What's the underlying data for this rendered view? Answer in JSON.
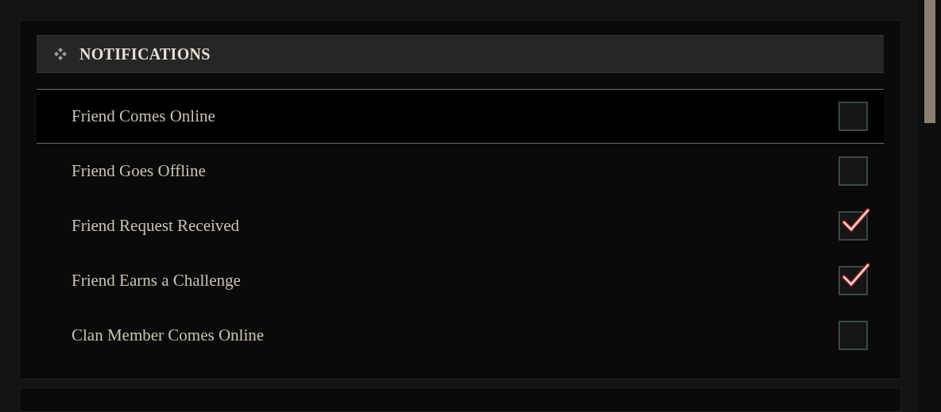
{
  "section": {
    "title": "NOTIFICATIONS"
  },
  "options": [
    {
      "label": "Friend Comes Online",
      "checked": false,
      "selected": true
    },
    {
      "label": "Friend Goes Offline",
      "checked": false,
      "selected": false
    },
    {
      "label": "Friend Request Received",
      "checked": true,
      "selected": false
    },
    {
      "label": "Friend Earns a Challenge",
      "checked": true,
      "selected": false
    },
    {
      "label": "Clan Member Comes Online",
      "checked": false,
      "selected": false
    }
  ]
}
